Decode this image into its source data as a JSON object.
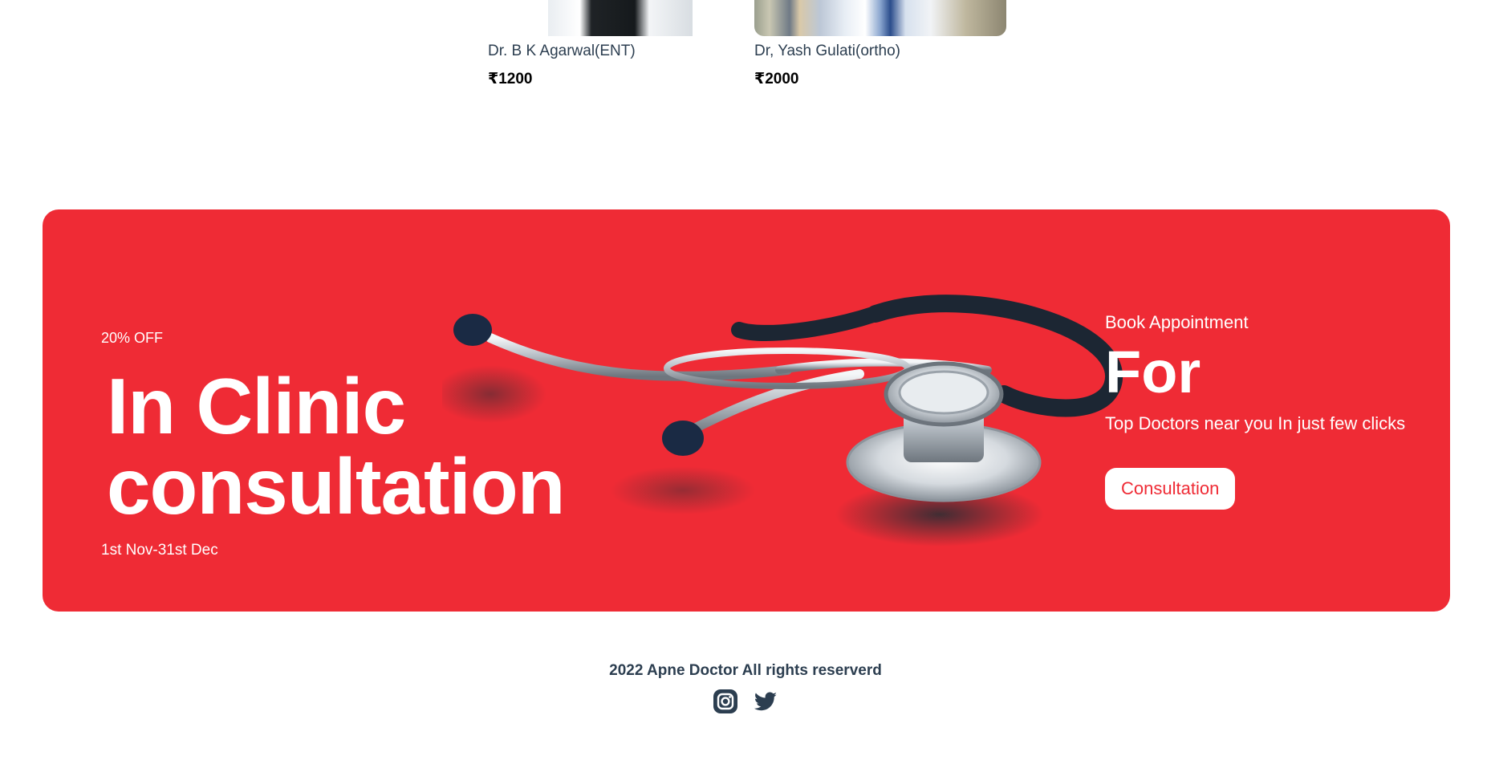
{
  "doctors": [
    {
      "name": "Dr. B K Agarwal(ENT)",
      "price": "₹1200"
    },
    {
      "name": "Dr, Yash Gulati(ortho)",
      "price": "₹2000"
    }
  ],
  "banner": {
    "offer": "20% OFF",
    "headline_line1": "In Clinic",
    "headline_line2": "consultation",
    "dates": "1st Nov-31st Dec",
    "book_label": "Book Appointment",
    "for_label": "For",
    "tagline": "Top Doctors near you In just few clicks",
    "cta_label": "Consultation",
    "bg_color": "#ef2b35"
  },
  "footer": {
    "copyright": "2022 Apne Doctor All rights reserverd",
    "socials": [
      "instagram-icon",
      "twitter-icon"
    ]
  }
}
